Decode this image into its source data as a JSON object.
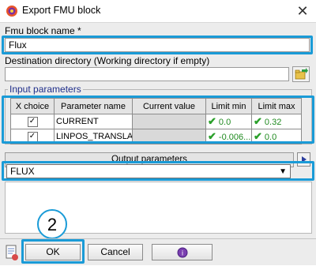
{
  "window": {
    "title": "Export FMU block",
    "close_glyph": "✕"
  },
  "fields": {
    "block_name_label": "Fmu block name *",
    "block_name_value": "Flux",
    "dest_dir_label": "Destination directory (Working directory if empty)",
    "dest_dir_value": ""
  },
  "input_parameters": {
    "title": "Input parameters",
    "columns": [
      "X choice",
      "Parameter name",
      "Current value",
      "Limit min",
      "Limit max"
    ],
    "rows": [
      {
        "checked": true,
        "name": "CURRENT",
        "current": "",
        "min": "0.0",
        "max": "0.32"
      },
      {
        "checked": true,
        "name": "LINPOS_TRANSLA...",
        "current": "",
        "min": "-0.006...",
        "max": "0.0"
      }
    ]
  },
  "output_parameters": {
    "header": "Output parameters",
    "selected": "FLUX"
  },
  "annotation": {
    "step": "2"
  },
  "buttons": {
    "ok": "OK",
    "cancel": "Cancel"
  },
  "icons": {
    "app": "flux-app-icon",
    "browse": "folder-arrow-icon",
    "play": "play-right-icon",
    "help": "help-icon",
    "export": "export-doc-icon"
  },
  "colors": {
    "highlight": "#1a9bd7",
    "group_title": "#1f2e8a",
    "limit_green": "#1f8a1f"
  }
}
